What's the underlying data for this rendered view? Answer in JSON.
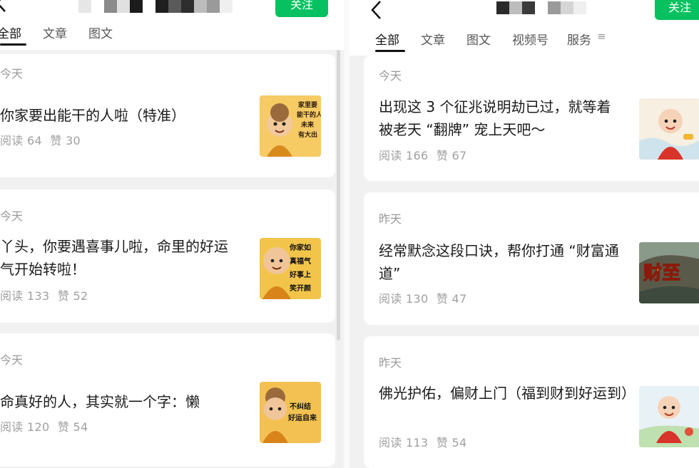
{
  "follow_label": "关注",
  "left": {
    "tabs": [
      "全部",
      "文章",
      "图文"
    ],
    "articles": [
      {
        "date": "今天",
        "title": "你家要出能干的人啦（特准）",
        "read_label": "阅读",
        "reads": "64",
        "like_label": "赞",
        "likes": "30",
        "thumb_text": "家里要\n能干的人\n未来\n有大出"
      },
      {
        "date": "今天",
        "title": "丫头，你要遇喜事儿啦，命里的好运气开始转啦！",
        "read_label": "阅读",
        "reads": "133",
        "like_label": "赞",
        "likes": "52",
        "thumb_text": "你家如\n真福气\n好事上\n笑开颜"
      },
      {
        "date": "今天",
        "title": "命真好的人，其实就一个字：懒",
        "read_label": "阅读",
        "reads": "120",
        "like_label": "赞",
        "likes": "54",
        "thumb_text": "不纠结\n好运自来"
      }
    ]
  },
  "right": {
    "tabs": [
      "全部",
      "文章",
      "图文",
      "视频号",
      "服务"
    ],
    "articles": [
      {
        "date": "今天",
        "title": "出现这 3 个征兆说明劫已过，就等着被老天 “翻牌” 宠上天吧～",
        "read_label": "阅读",
        "reads": "166",
        "like_label": "赞",
        "likes": "67"
      },
      {
        "date": "昨天",
        "title": "经常默念这段口诀，帮你打通 “财富通道”",
        "read_label": "阅读",
        "reads": "130",
        "like_label": "赞",
        "likes": "47",
        "thumb_text": "财至"
      },
      {
        "date": "昨天",
        "title": "佛光护佑，偏财上门（福到财到好运到）",
        "read_label": "阅读",
        "reads": "113",
        "like_label": "赞",
        "likes": "54"
      }
    ]
  },
  "colors": {
    "accent": "#07c160",
    "text_primary": "#1a1a1a",
    "text_muted": "#999999",
    "background": "#f1f1f1"
  },
  "icons": {
    "back": "chevron-left-icon",
    "menu": "menu-icon"
  }
}
